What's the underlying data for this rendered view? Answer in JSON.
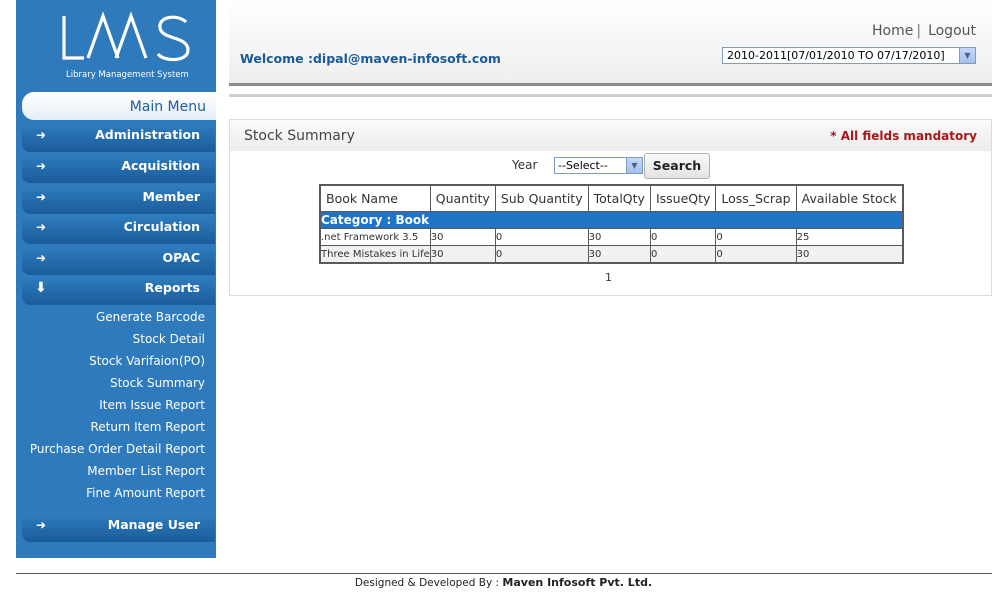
{
  "header": {
    "home_label": "Home",
    "logout_label": "Logout",
    "welcome_text": "Welcome :dipal@maven-infosoft.com",
    "session_year": "2010-2011[07/01/2010 TO 07/17/2010]"
  },
  "logo": {
    "title": "LMS",
    "subtitle": "Library Management System"
  },
  "sidebar": {
    "main_menu_label": "Main Menu",
    "items": [
      {
        "label": "Administration",
        "icon": "arrow-right-icon"
      },
      {
        "label": "Acquisition",
        "icon": "arrow-right-icon"
      },
      {
        "label": "Member",
        "icon": "arrow-right-icon"
      },
      {
        "label": "Circulation",
        "icon": "arrow-right-icon"
      },
      {
        "label": "OPAC",
        "icon": "arrow-right-icon"
      },
      {
        "label": "Reports",
        "icon": "arrow-down-icon"
      }
    ],
    "report_links": [
      "Generate Barcode",
      "Stock Detail",
      "Stock Varifaion(PO)",
      "Stock Summary",
      "Item Issue Report",
      "Return Item Report",
      "Purchase Order Detail Report",
      "Member List Report",
      "Fine Amount Report"
    ],
    "manage_user_label": "Manage User"
  },
  "panel": {
    "title": "Stock Summary",
    "mandatory_note": "* All fields mandatory",
    "year_label": "Year",
    "year_select_value": "--Select--",
    "search_label": "Search"
  },
  "table": {
    "columns": [
      "Book Name",
      "Quantity",
      "Sub Quantity",
      "TotalQty",
      "IssueQty",
      "Loss_Scrap",
      "Available Stock"
    ],
    "category_label": "Category : Book",
    "rows": [
      [
        ".net Framework 3.5",
        "30",
        "0",
        "30",
        "0",
        "0",
        "25"
      ],
      [
        "Three Mistakes in Life",
        "30",
        "0",
        "30",
        "0",
        "0",
        "30"
      ]
    ],
    "pager": "1"
  },
  "footer": {
    "prefix": "Designed & Developed By : ",
    "company": "Maven Infosoft Pvt. Ltd."
  },
  "colors": {
    "sidebar_bg": "#2f79bd",
    "category_bar": "#1f74c5",
    "mandatory_red": "#a8191b",
    "welcome_blue": "#1b5a98"
  }
}
